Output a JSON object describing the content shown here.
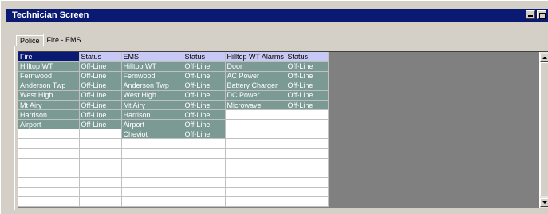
{
  "window": {
    "title": "Technician Screen"
  },
  "tabs": [
    "Police",
    "Fire - EMS"
  ],
  "active_tab": 1,
  "grid": {
    "headers": [
      "Fire",
      "Status",
      "EMS",
      "Status",
      "Hilltop WT Alarms",
      "Status"
    ],
    "rows": [
      [
        "Hilltop WT",
        "Off-Line",
        "Hilltop WT",
        "Off-Line",
        "Door",
        "Off-Line"
      ],
      [
        "Fernwood",
        "Off-Line",
        "Fernwood",
        "Off-Line",
        "AC Power",
        "Off-Line"
      ],
      [
        "Anderson Twp",
        "Off-Line",
        "Anderson Twp",
        "Off-Line",
        "Battery Charger",
        "Off-Line"
      ],
      [
        "West High",
        "Off-Line",
        "West High",
        "Off-Line",
        "DC Power",
        "Off-Line"
      ],
      [
        "Mt Airy",
        "Off-Line",
        "Mt Airy",
        "Off-Line",
        "Microwave",
        "Off-Line"
      ],
      [
        "Harrison",
        "Off-Line",
        "Harrison",
        "Off-Line",
        "",
        ""
      ],
      [
        "Airport",
        "Off-Line",
        "Airport",
        "Off-Line",
        "",
        ""
      ],
      [
        "",
        "",
        "Cheviot",
        "Off-Line",
        "",
        ""
      ],
      [
        "",
        "",
        "",
        "",
        "",
        ""
      ],
      [
        "",
        "",
        "",
        "",
        "",
        ""
      ],
      [
        "",
        "",
        "",
        "",
        "",
        ""
      ],
      [
        "",
        "",
        "",
        "",
        "",
        ""
      ],
      [
        "",
        "",
        "",
        "",
        "",
        ""
      ],
      [
        "",
        "",
        "",
        "",
        "",
        ""
      ],
      [
        "",
        "",
        "",
        "",
        "",
        ""
      ]
    ]
  },
  "colors": {
    "titlebar": "#0a1a73",
    "filled_cell": "#7b9a94",
    "header": "#c8c8f4",
    "selected_header": "#0a1a73"
  },
  "icons": {
    "minimize": "minimize-icon",
    "maximize": "maximize-icon",
    "scroll_up": "arrow-up-icon",
    "scroll_down": "arrow-down-icon"
  }
}
